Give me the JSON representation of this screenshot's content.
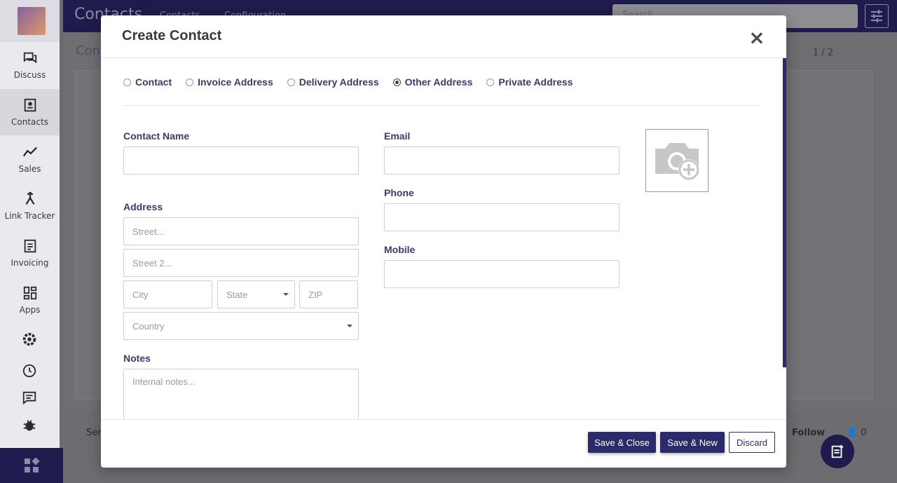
{
  "app": {
    "brand": "Contacts",
    "menu": [
      "Contacts",
      "Configuration"
    ],
    "search_placeholder": "Search...",
    "breadcrumb": "Cont",
    "pager": "1 / 2",
    "follow": "Follow",
    "followers_count": "0",
    "send_label": "Sen"
  },
  "sidebar": {
    "items": [
      {
        "label": "Discuss",
        "icon": "chat-icon"
      },
      {
        "label": "Contacts",
        "icon": "contact-card-icon"
      },
      {
        "label": "Sales",
        "icon": "trend-icon"
      },
      {
        "label": "Link Tracker",
        "icon": "merge-icon"
      },
      {
        "label": "Invoicing",
        "icon": "invoice-icon"
      },
      {
        "label": "Apps",
        "icon": "apps-icon"
      }
    ]
  },
  "modal": {
    "title": "Create Contact",
    "close_label": "×",
    "address_types": [
      {
        "label": "Contact",
        "checked": false
      },
      {
        "label": "Invoice Address",
        "checked": false
      },
      {
        "label": "Delivery Address",
        "checked": false
      },
      {
        "label": "Other Address",
        "checked": true
      },
      {
        "label": "Private Address",
        "checked": false
      }
    ],
    "fields": {
      "contact_name_label": "Contact Name",
      "contact_name_value": "",
      "address_label": "Address",
      "street_placeholder": "Street...",
      "street2_placeholder": "Street 2...",
      "city_placeholder": "City",
      "state_placeholder": "State",
      "zip_placeholder": "ZIP",
      "country_placeholder": "Country",
      "notes_label": "Notes",
      "notes_placeholder": "Internal notes...",
      "email_label": "Email",
      "email_value": "",
      "phone_label": "Phone",
      "phone_value": "",
      "mobile_label": "Mobile",
      "mobile_value": ""
    },
    "buttons": {
      "save_close": "Save & Close",
      "save_new": "Save & New",
      "discard": "Discard"
    }
  },
  "colors": {
    "primary": "#2b2a6b",
    "label": "#3b3b6b"
  }
}
